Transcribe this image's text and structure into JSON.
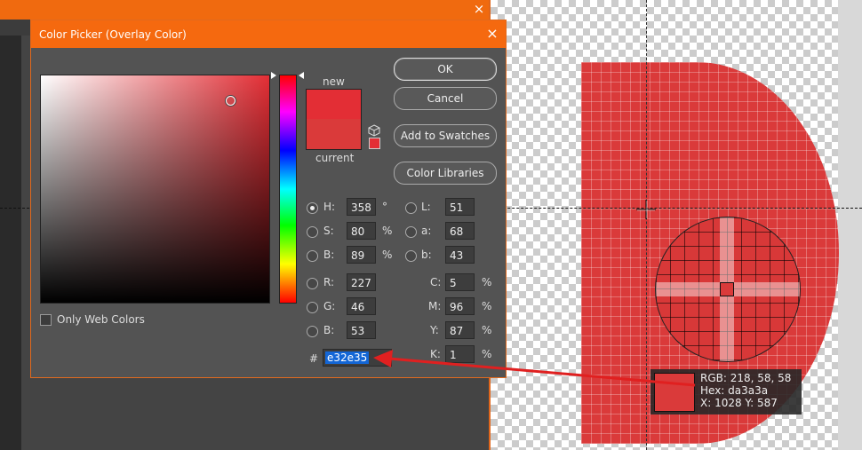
{
  "dialog": {
    "title": "Color Picker (Overlay Color)",
    "close_icon": "×",
    "new_label": "new",
    "current_label": "current",
    "new_color": "#e32e35",
    "current_color": "#da3a3a",
    "only_web_colors_label": "Only Web Colors",
    "buttons": {
      "ok": "OK",
      "cancel": "Cancel",
      "add_to_swatches": "Add to Swatches",
      "color_libraries": "Color Libraries"
    },
    "fields": {
      "h": {
        "label": "H:",
        "value": "358",
        "unit": "°"
      },
      "s": {
        "label": "S:",
        "value": "80",
        "unit": "%"
      },
      "b": {
        "label": "B:",
        "value": "89",
        "unit": "%"
      },
      "r": {
        "label": "R:",
        "value": "227"
      },
      "g": {
        "label": "G:",
        "value": "46"
      },
      "bl": {
        "label": "B:",
        "value": "53"
      },
      "l": {
        "label": "L:",
        "value": "51"
      },
      "a": {
        "label": "a:",
        "value": "68"
      },
      "lb": {
        "label": "b:",
        "value": "43"
      },
      "c": {
        "label": "C:",
        "value": "5",
        "unit": "%"
      },
      "m": {
        "label": "M:",
        "value": "96",
        "unit": "%"
      },
      "y": {
        "label": "Y:",
        "value": "87",
        "unit": "%"
      },
      "k": {
        "label": "K:",
        "value": "1",
        "unit": "%"
      }
    },
    "hex_label": "#",
    "hex_value": "e32e35"
  },
  "sampler": {
    "rgb": "RGB: 218, 58, 58",
    "hex": "Hex: da3a3a",
    "xy": "X: 1028 Y: 587",
    "color": "#da3a3a"
  },
  "background": {
    "close_icon": "×"
  },
  "colors": {
    "accent": "#f5690f",
    "selection": "#1366d6",
    "arrow": "#e02020"
  }
}
